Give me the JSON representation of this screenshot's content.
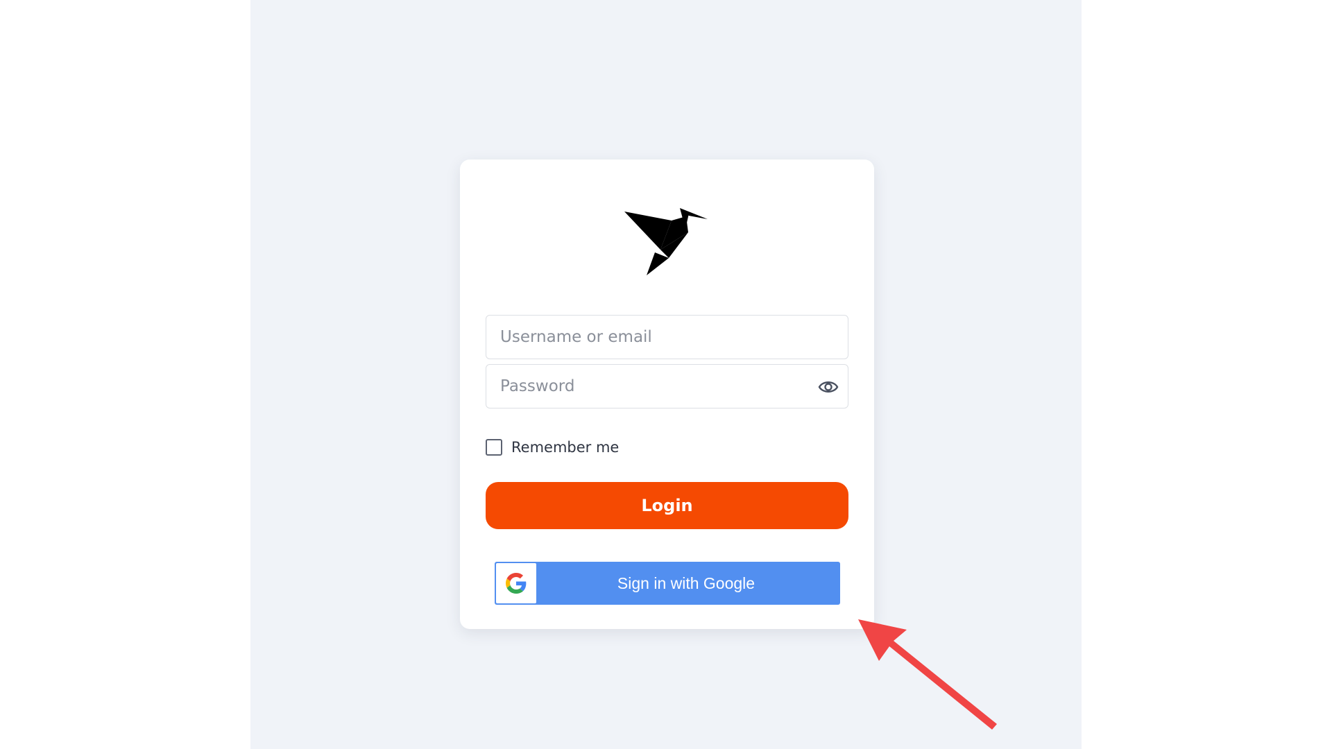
{
  "login_form": {
    "username_placeholder": "Username or email",
    "password_placeholder": "Password",
    "remember_me_label": "Remember me",
    "login_label": "Login",
    "google_signin_label": "Sign in with Google"
  },
  "icons": {
    "logo": "origami-bird-logo",
    "password_toggle": "eye-icon",
    "google": "google-g-icon",
    "annotation": "red-arrow-annotation"
  },
  "colors": {
    "background": "#f0f3f8",
    "card": "#ffffff",
    "login_button": "#f54a02",
    "google_button": "#528ff0",
    "annotation_arrow": "#f04545"
  },
  "remember_me_checked": false
}
